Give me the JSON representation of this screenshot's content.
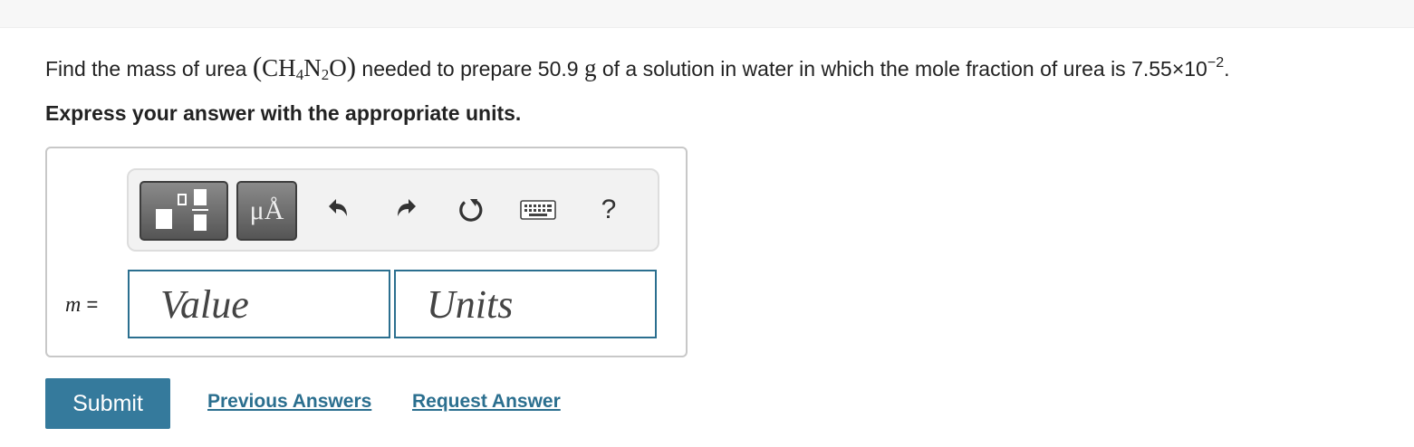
{
  "question": {
    "prefix": "Find the mass of urea ",
    "formula_open": "(",
    "formula_c": "CH",
    "formula_h_sub": "4",
    "formula_n": "N",
    "formula_n_sub": "2",
    "formula_o": "O",
    "formula_close": ")",
    "middle1": " needed to prepare 50.9 ",
    "unit_g": "g",
    "middle2": " of a solution in water in which the mole fraction of urea is 7.55×10",
    "exponent": "−2",
    "suffix": "."
  },
  "instruction": "Express your answer with the appropriate units.",
  "toolbar": {
    "units_label": "μÅ",
    "icons": [
      "templates-icon",
      "units-icon",
      "undo-icon",
      "redo-icon",
      "reset-icon",
      "keyboard-icon",
      "help-icon"
    ],
    "help_label": "?"
  },
  "answer": {
    "variable": "m",
    "equals": " =",
    "value_placeholder": "Value",
    "units_placeholder": "Units"
  },
  "actions": {
    "submit_label": "Submit",
    "previous_answers_label": "Previous Answers",
    "request_answer_label": "Request Answer"
  },
  "colors": {
    "accent": "#357a9c",
    "link": "#2b6f8f",
    "field_border": "#2b6f8f",
    "toolbar_bg": "#f2f2f2"
  }
}
